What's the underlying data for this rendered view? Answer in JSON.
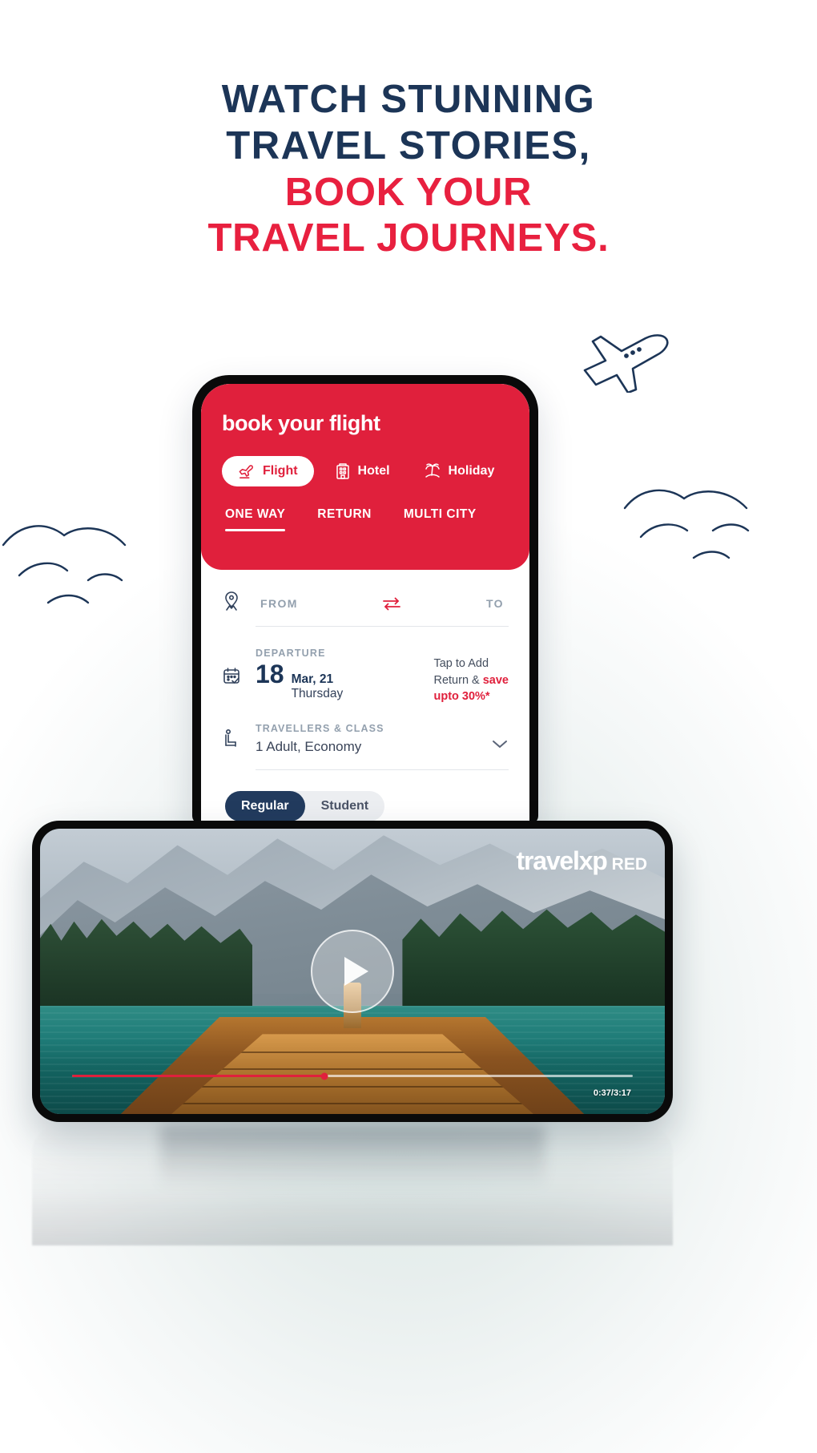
{
  "headline": {
    "line1": "WATCH STUNNING",
    "line2": "TRAVEL STORIES,",
    "line3": "BOOK YOUR",
    "line4": "TRAVEL JOURNEYS.",
    "navy_color": "#1c3557",
    "red_color": "#e8203f"
  },
  "app": {
    "title": "book your flight",
    "accent_color": "#e0203c",
    "categories": [
      {
        "label": "Flight",
        "icon": "airplane-takeoff-icon",
        "active": true
      },
      {
        "label": "Hotel",
        "icon": "hotel-building-icon",
        "active": false
      },
      {
        "label": "Holiday",
        "icon": "palm-island-icon",
        "active": false
      }
    ],
    "trip_tabs": [
      {
        "label": "ONE WAY",
        "active": true
      },
      {
        "label": "RETURN",
        "active": false
      },
      {
        "label": "MULTI CITY",
        "active": false
      }
    ],
    "route": {
      "location_icon": "location-pin-icon",
      "from_label": "FROM",
      "to_label": "TO",
      "swap_icon": "swap-arrows-icon"
    },
    "departure": {
      "calendar_icon": "calendar-icon",
      "caption": "DEPARTURE",
      "day": "18",
      "month_year": "Mar, 21",
      "weekday": "Thursday",
      "promo_line1": "Tap to Add",
      "promo_line2_prefix": "Return & ",
      "promo_line2_bold": "save",
      "promo_line3": "upto 30%*"
    },
    "travellers": {
      "seat_icon": "seated-passenger-icon",
      "caption": "TRAVELLERS & CLASS",
      "value": "1 Adult, Economy",
      "chevron_icon": "chevron-down-icon"
    },
    "fare_types": [
      {
        "label": "Regular",
        "active": true
      },
      {
        "label": "Student",
        "active": false
      }
    ]
  },
  "video": {
    "logo_main": "travelxp",
    "logo_sub": "RED",
    "play_icon": "play-icon",
    "timestamp": "0:37/3:17",
    "progress_percent": 45
  },
  "decor": {
    "plane_icon": "airplane-doodle-icon",
    "birds_right_icon": "birds-doodle-icon",
    "birds_left_icon": "birds-doodle-icon"
  }
}
